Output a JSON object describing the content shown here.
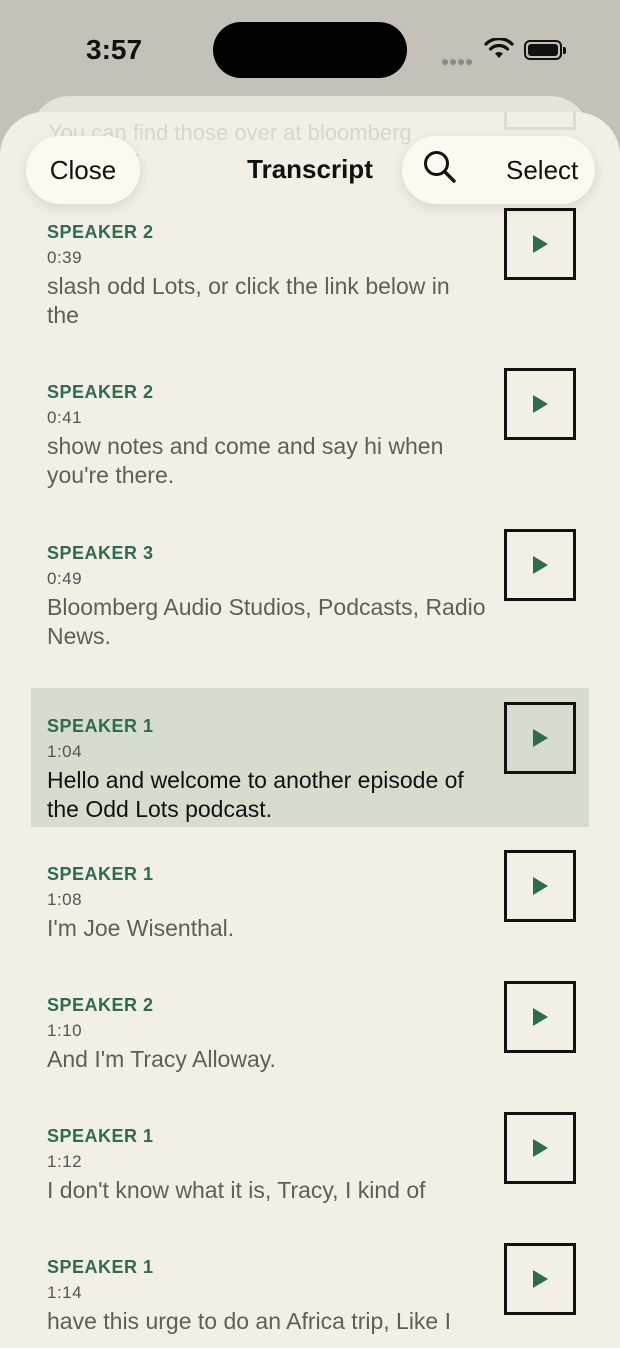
{
  "status": {
    "time": "3:57"
  },
  "header": {
    "close_label": "Close",
    "title": "Transcript",
    "select_label": "Select"
  },
  "background_partial_text": "You can find those over at bloomberg\n...forward",
  "entries": [
    {
      "speaker": "SPEAKER 2",
      "time": "0:39",
      "text": "slash odd Lots, or click the link below in the",
      "active": false
    },
    {
      "speaker": "SPEAKER 2",
      "time": "0:41",
      "text": "show notes and come and say hi when you're there.",
      "active": false
    },
    {
      "speaker": "SPEAKER 3",
      "time": "0:49",
      "text": "Bloomberg Audio Studios, Podcasts, Radio News.",
      "active": false
    },
    {
      "speaker": "SPEAKER 1",
      "time": "1:04",
      "text": "Hello and welcome to another episode of the Odd Lots podcast.",
      "active": true
    },
    {
      "speaker": "SPEAKER 1",
      "time": "1:08",
      "text": "I'm Joe Wisenthal.",
      "active": false
    },
    {
      "speaker": "SPEAKER 2",
      "time": "1:10",
      "text": "And I'm Tracy Alloway.",
      "active": false
    },
    {
      "speaker": "SPEAKER 1",
      "time": "1:12",
      "text": "I don't know what it is, Tracy, I kind of",
      "active": false
    },
    {
      "speaker": "SPEAKER 1",
      "time": "1:14",
      "text": "have this urge to do an Africa trip, Like I",
      "active": false
    }
  ],
  "colors": {
    "accent": "#2e6b4f",
    "sheet": "#f2efe4",
    "highlight": "#d6ddce"
  }
}
